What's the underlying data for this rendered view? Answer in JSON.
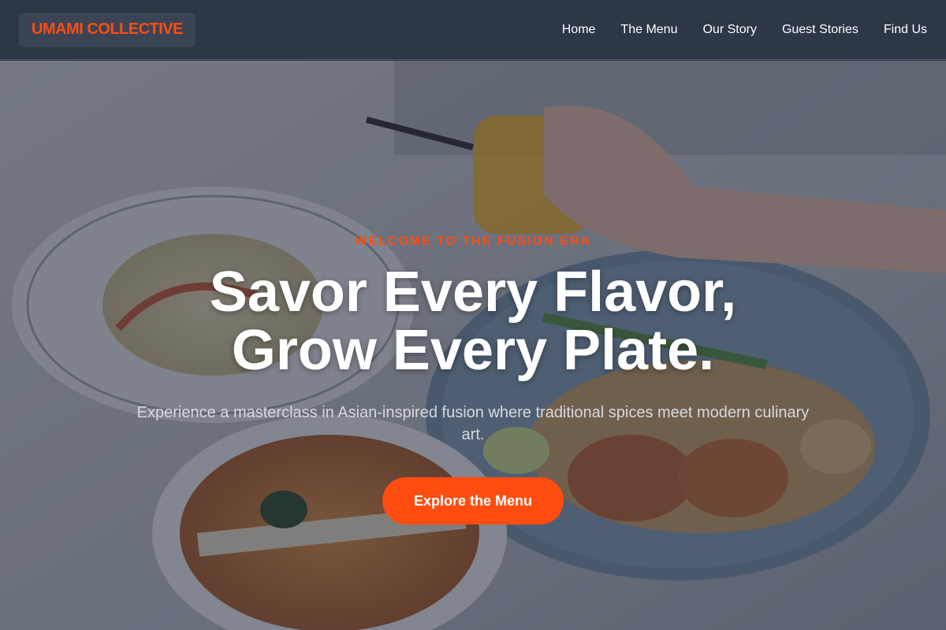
{
  "header": {
    "logo": "UMAMI COLLECTIVE",
    "nav": [
      {
        "label": "Home"
      },
      {
        "label": "The Menu"
      },
      {
        "label": "Our Story"
      },
      {
        "label": "Guest Stories"
      },
      {
        "label": "Find Us"
      }
    ]
  },
  "hero": {
    "eyebrow": "WELCOME TO THE FUSION ERA",
    "headline_line1": "Savor Every Flavor,",
    "headline_line2": "Grow Every Plate.",
    "subtitle": "Experience a masterclass in Asian-inspired fusion where traditional spices meet modern culinary art.",
    "cta_label": "Explore the Menu",
    "background_image": "food-photo-pad-thai-noodles-soup-drink"
  },
  "colors": {
    "accent": "#ff4d12",
    "header_bg": "#2d3748",
    "logo_bg": "#3a4454",
    "text_light": "#ffffff"
  }
}
